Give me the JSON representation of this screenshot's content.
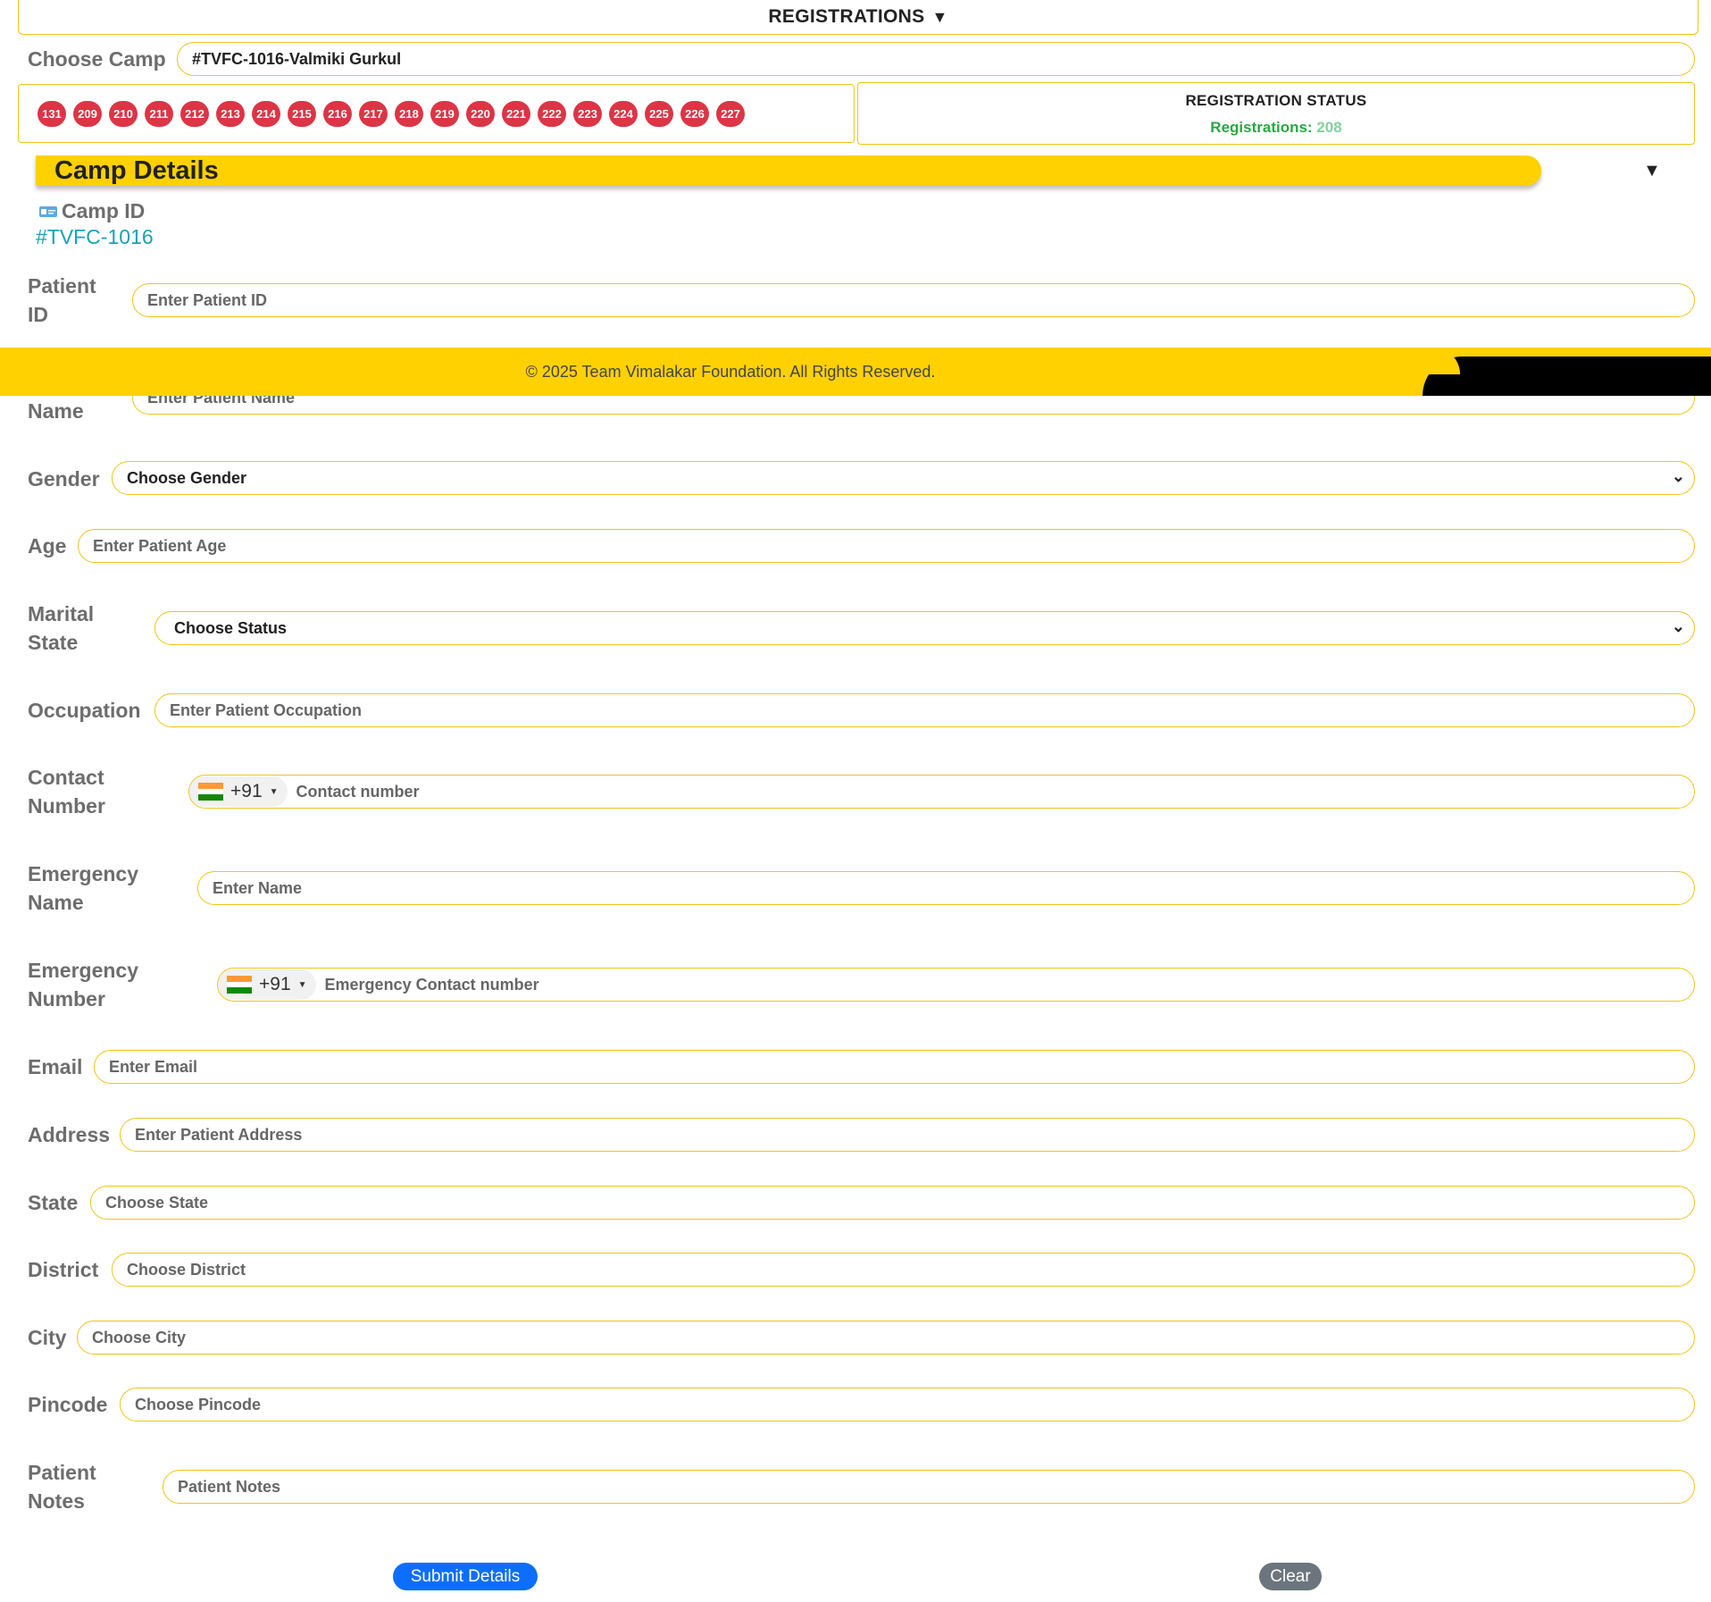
{
  "header": {
    "title": "REGISTRATIONS",
    "caret": "▼"
  },
  "camp_select": {
    "label": "Choose Camp",
    "value": "#TVFC-1016-Valmiki Gurkul"
  },
  "tokens": [
    "131",
    "209",
    "210",
    "211",
    "212",
    "213",
    "214",
    "215",
    "216",
    "217",
    "218",
    "219",
    "220",
    "221",
    "222",
    "223",
    "224",
    "225",
    "226",
    "227"
  ],
  "status": {
    "title": "REGISTRATION STATUS",
    "label": "Registrations:",
    "count": "208",
    "label_color": "#28a745"
  },
  "camp_details": {
    "title": "Camp Details",
    "caret": "▼",
    "camp_id_label": "Camp ID",
    "camp_id_value": "#TVFC-1016",
    "icon": "id-card-icon"
  },
  "footer": {
    "text": "© 2025 Team Vimalakar Foundation. All Rights Reserved."
  },
  "form": {
    "patient_id": {
      "label_1": "Patient",
      "label_2": "ID",
      "placeholder": "Enter Patient ID"
    },
    "name": {
      "label": "Name",
      "placeholder": "Enter Patient Name"
    },
    "gender": {
      "label": "Gender",
      "value": "Choose Gender"
    },
    "age": {
      "label": "Age",
      "placeholder": "Enter Patient Age"
    },
    "marital": {
      "label_1": "Marital",
      "label_2": "State",
      "value": "Choose Status"
    },
    "occupation": {
      "label": "Occupation",
      "placeholder": "Enter Patient Occupation"
    },
    "contact": {
      "label_1": "Contact",
      "label_2": "Number",
      "code": "+91",
      "placeholder": "Contact number"
    },
    "emergency_name": {
      "label_1": "Emergency",
      "label_2": "Name",
      "placeholder": "Enter Name"
    },
    "emergency_number": {
      "label_1": "Emergency",
      "label_2": "Number",
      "code": "+91",
      "placeholder": "Emergency Contact number"
    },
    "email": {
      "label": "Email",
      "placeholder": "Enter Email"
    },
    "address": {
      "label": "Address",
      "placeholder": "Enter Patient Address"
    },
    "state": {
      "label": "State",
      "placeholder": "Choose State"
    },
    "district": {
      "label": "District",
      "placeholder": "Choose District"
    },
    "city": {
      "label": "City",
      "placeholder": "Choose City"
    },
    "pincode": {
      "label": "Pincode",
      "placeholder": "Choose Pincode"
    },
    "notes": {
      "label_1": "Patient",
      "label_2": "Notes",
      "placeholder": "Patient Notes"
    }
  },
  "buttons": {
    "submit": "Submit Details",
    "clear": "Clear",
    "submit_color": "#0d6efd",
    "clear_color": "#6c757d"
  },
  "colors": {
    "accent": "#ffd100",
    "border": "#f0c419",
    "token": "#dc3545",
    "link": "#17a2b8"
  }
}
